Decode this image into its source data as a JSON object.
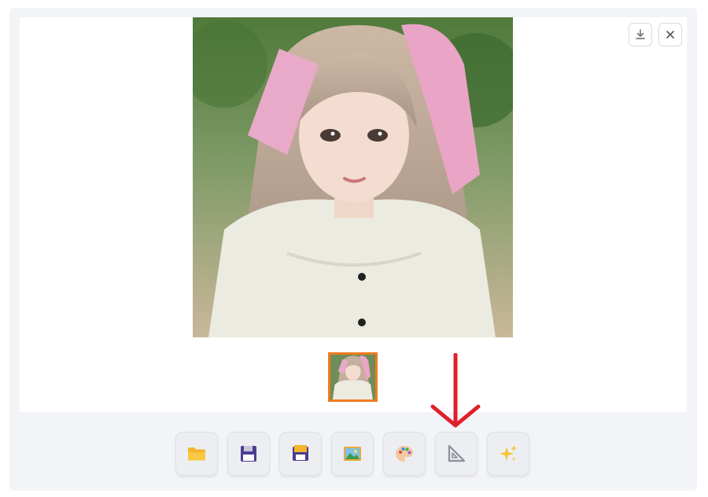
{
  "viewer": {
    "download_button": {
      "icon": "download-icon",
      "tooltip": ""
    },
    "close_button": {
      "icon": "close-icon",
      "tooltip": ""
    },
    "main_image": {
      "subject": "portrait"
    },
    "gallery": {
      "selected_index": 0,
      "accent": "#f07a1e"
    }
  },
  "toolbar": {
    "buttons": [
      {
        "icon": "folder-icon",
        "label": ""
      },
      {
        "icon": "save-icon",
        "label": ""
      },
      {
        "icon": "save-alt-icon",
        "label": ""
      },
      {
        "icon": "image-icon",
        "label": ""
      },
      {
        "icon": "palette-icon",
        "label": ""
      },
      {
        "icon": "triangle-ruler-icon",
        "label": ""
      },
      {
        "icon": "sparkles-icon",
        "label": ""
      }
    ]
  },
  "annotation": {
    "color": "#e0202a",
    "points_to": "triangle-ruler-icon"
  }
}
